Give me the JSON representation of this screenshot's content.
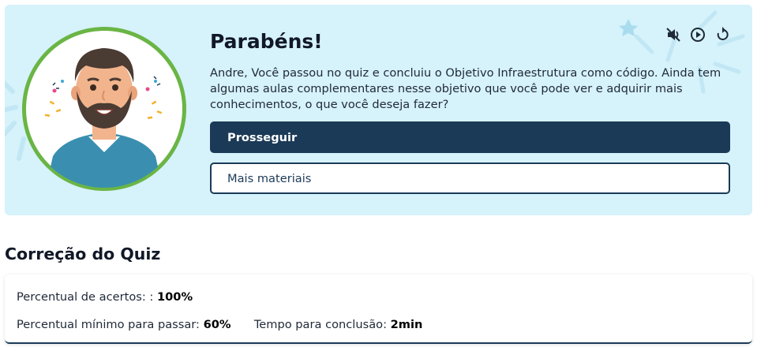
{
  "banner": {
    "title": "Parabéns!",
    "message": "Andre, Você passou no quiz e concluiu o Objetivo Infraestrutura como código. Ainda tem algumas aulas complementares nesse objetivo que você pode ver e adquirir mais conhecimentos, o que você deseja fazer?",
    "primary_button": "Prosseguir",
    "secondary_button": "Mais materiais",
    "background_color": "#d6f2fb",
    "button_color": "#1b3a57",
    "avatar_ring_color": "#6ab545",
    "media_controls": [
      {
        "icon": "mute-icon"
      },
      {
        "icon": "play-circle-icon"
      },
      {
        "icon": "replay-icon"
      }
    ]
  },
  "correction": {
    "title": "Correção do Quiz",
    "accuracy_label": "Percentual de acertos: :",
    "accuracy_value": "100%",
    "min_pass_label": "Percentual mínimo para passar:",
    "min_pass_value": "60%",
    "time_label": "Tempo para conclusão:",
    "time_value": "2min"
  }
}
